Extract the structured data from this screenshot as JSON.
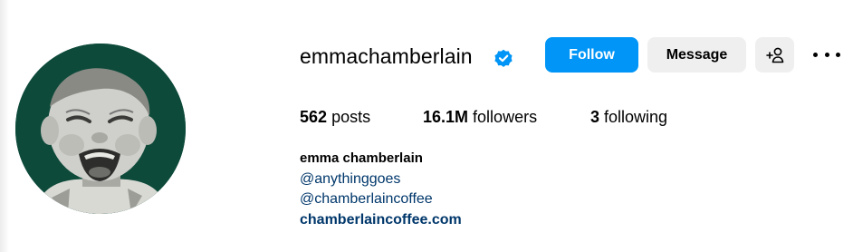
{
  "profile": {
    "username": "emmachamberlain",
    "verified_icon": "verified-badge-icon",
    "avatar_icon": "profile-photo"
  },
  "actions": {
    "follow_label": "Follow",
    "message_label": "Message",
    "add_user_icon": "add-user-icon",
    "more_icon": "more-options-icon"
  },
  "stats": {
    "posts_count": "562",
    "posts_label": "posts",
    "followers_count": "16.1M",
    "followers_label": "followers",
    "following_count": "3",
    "following_label": "following"
  },
  "bio": {
    "full_name": "emma chamberlain",
    "mention_1": "@anythinggoes",
    "mention_2": "@chamberlaincoffee",
    "website": "chamberlaincoffee.com"
  },
  "colors": {
    "primary_button": "#0095f6",
    "secondary_button": "#efefef",
    "link": "#00376b",
    "verified": "#0095f6",
    "avatar_bg": "#0d4a3a"
  }
}
